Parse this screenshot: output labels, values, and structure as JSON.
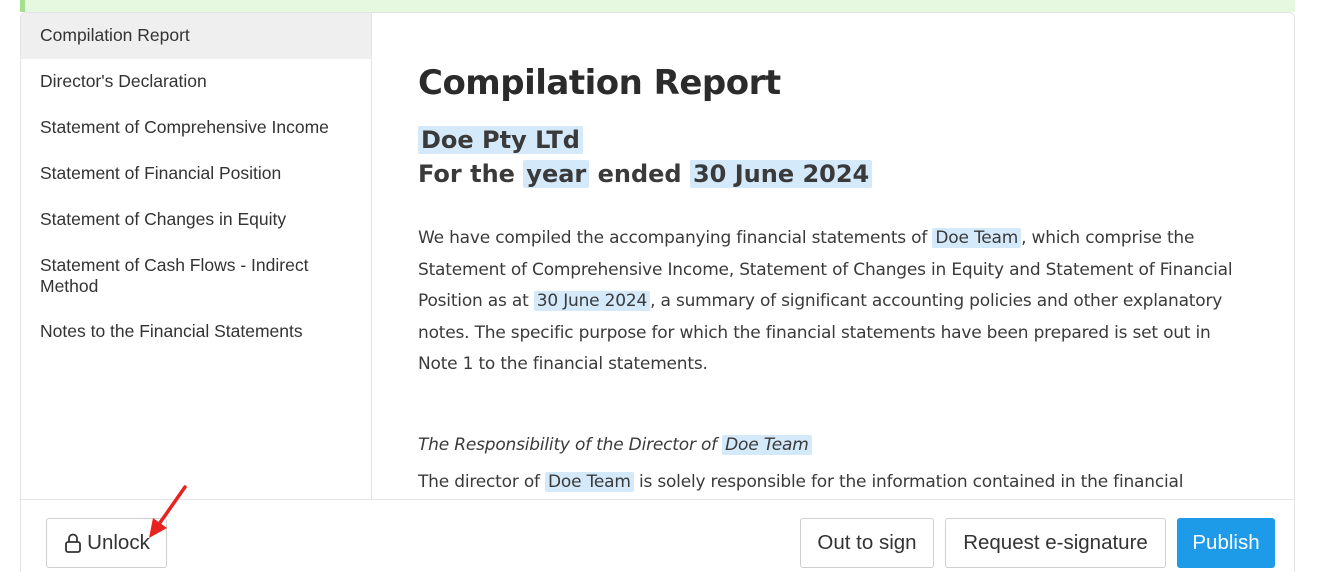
{
  "sidebar": {
    "items": [
      {
        "label": "Compilation Report"
      },
      {
        "label": "Director's Declaration"
      },
      {
        "label": "Statement of Comprehensive Income"
      },
      {
        "label": "Statement of Financial Position"
      },
      {
        "label": "Statement of Changes in Equity"
      },
      {
        "label": "Statement of Cash Flows - Indirect Method"
      },
      {
        "label": "Notes to the Financial Statements"
      }
    ]
  },
  "document": {
    "title": "Compilation Report",
    "entity_name": "Doe Pty LTd",
    "period_prefix": "For the",
    "period_type": "year",
    "period_mid": "ended",
    "period_date": "30 June 2024",
    "intro_p1": "We have compiled the accompanying financial statements of",
    "intro_entity": "Doe Team",
    "intro_p2": ", which comprise the Statement of Comprehensive Income, Statement of Changes in Equity and Statement of Financial Position as at",
    "intro_date": "30 June 2024",
    "intro_p3": ", a summary of significant accounting policies and other explanatory notes. The specific purpose for which the financial statements have been prepared is set out in Note 1 to the financial statements.",
    "responsibility_heading": "The Responsibility of the Director of",
    "responsibility_entity": "Doe Team",
    "resp_p1": "The director of",
    "resp_entity": "Doe Team",
    "resp_p2": "is solely responsible for the information contained in the financial"
  },
  "footer": {
    "unlock_label": "Unlock",
    "out_to_sign_label": "Out to sign",
    "esignature_label": "Request e-signature",
    "publish_label": "Publish"
  },
  "colors": {
    "accent": "#1e9be8",
    "highlight": "#d4e9fa",
    "annotation_arrow": "#e8231f"
  }
}
